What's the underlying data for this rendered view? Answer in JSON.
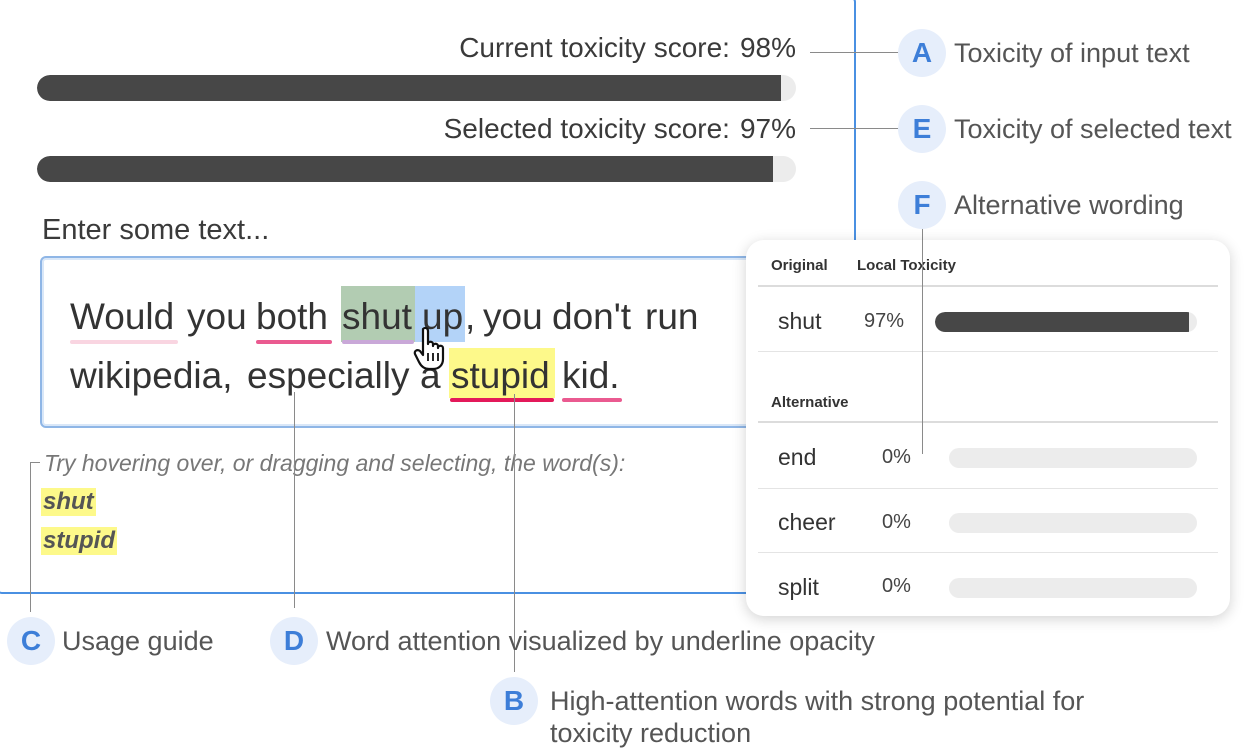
{
  "scores": {
    "current_label": "Current toxicity score:",
    "current_value": "98%",
    "current_fraction": 0.98,
    "selected_label": "Selected toxicity score:",
    "selected_value": "97%",
    "selected_fraction": 0.97
  },
  "input": {
    "label": "Enter some text...",
    "words": [
      "Would",
      "you",
      "both",
      "shut",
      "up",
      ",",
      "you",
      "don't",
      "run",
      "wikipedia,",
      "especially",
      "a",
      "stupid",
      "kid."
    ]
  },
  "guide": {
    "text": "Try hovering over, or dragging and selecting, the word(s):",
    "words": [
      "shut",
      "stupid"
    ]
  },
  "annotations": {
    "A": {
      "badge": "A",
      "text": "Toxicity of input text"
    },
    "E": {
      "badge": "E",
      "text": "Toxicity of selected text"
    },
    "F": {
      "badge": "F",
      "text": "Alternative wording"
    },
    "C": {
      "badge": "C",
      "text": "Usage guide"
    },
    "D": {
      "badge": "D",
      "text": "Word attention visualized by underline opacity"
    },
    "B": {
      "badge": "B",
      "text_line1": "High-attention words with strong potential for",
      "text_line2": "toxicity reduction"
    }
  },
  "card": {
    "original_header": "Original",
    "toxicity_header": "Local Toxicity",
    "alternative_header": "Alternative",
    "original": {
      "word": "shut",
      "pct": "97%",
      "fraction": 0.97
    },
    "alternatives": [
      {
        "word": "end",
        "pct": "0%",
        "fraction": 0.0
      },
      {
        "word": "cheer",
        "pct": "0%",
        "fraction": 0.0
      },
      {
        "word": "split",
        "pct": "0%",
        "fraction": 0.0
      }
    ]
  },
  "colors": {
    "accent": "#4a90e2",
    "bar": "#474747",
    "highlight_yellow": "#fdf98a",
    "selection_blue": "#b3d3f8",
    "selection_green": "#b2ccb2",
    "underline_strong": "#e3195a",
    "underline_medium": "#ea5a90",
    "underline_weak": "#f6c9d8"
  }
}
